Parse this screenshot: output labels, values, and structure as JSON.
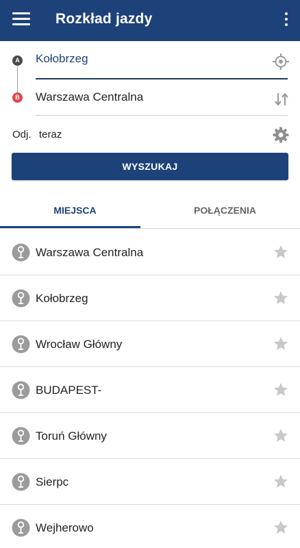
{
  "app_bar": {
    "title": "Rozkład jazdy",
    "menu_icon": "hamburger-menu-icon",
    "more_icon": "more-vertical-icon",
    "background": "#1d4279"
  },
  "route": {
    "from_marker": "A",
    "to_marker": "B",
    "from_value": "Kołobrzeg",
    "to_value": "Warszawa Centralna",
    "marker_a_color": "#4a4a4a",
    "marker_b_color": "#e0474c",
    "locate_icon": "gps-locate-icon",
    "swap_icon": "swap-vertical-icon"
  },
  "departure": {
    "label": "Odj.",
    "value": "teraz",
    "settings_icon": "gear-icon"
  },
  "search_button": {
    "label": "WYSZUKAJ"
  },
  "tabs": [
    {
      "label": "MIEJSCA",
      "active": true
    },
    {
      "label": "POŁĄCZENIA",
      "active": false
    }
  ],
  "places": [
    {
      "name": "Warszawa Centralna",
      "icon": "station-pin-icon",
      "favorite": false
    },
    {
      "name": "Kołobrzeg",
      "icon": "station-pin-icon",
      "favorite": false
    },
    {
      "name": "Wrocław Główny",
      "icon": "station-pin-icon",
      "favorite": false
    },
    {
      "name": "BUDAPEST-",
      "icon": "station-pin-icon",
      "favorite": false
    },
    {
      "name": "Toruń Główny",
      "icon": "station-pin-icon",
      "favorite": false
    },
    {
      "name": "Sierpc",
      "icon": "station-pin-icon",
      "favorite": false
    },
    {
      "name": "Wejherowo",
      "icon": "station-pin-icon",
      "favorite": false
    }
  ],
  "colors": {
    "primary": "#1d4279",
    "icon_gray": "#9b9b9b",
    "star_gray": "#c8c8c8"
  }
}
